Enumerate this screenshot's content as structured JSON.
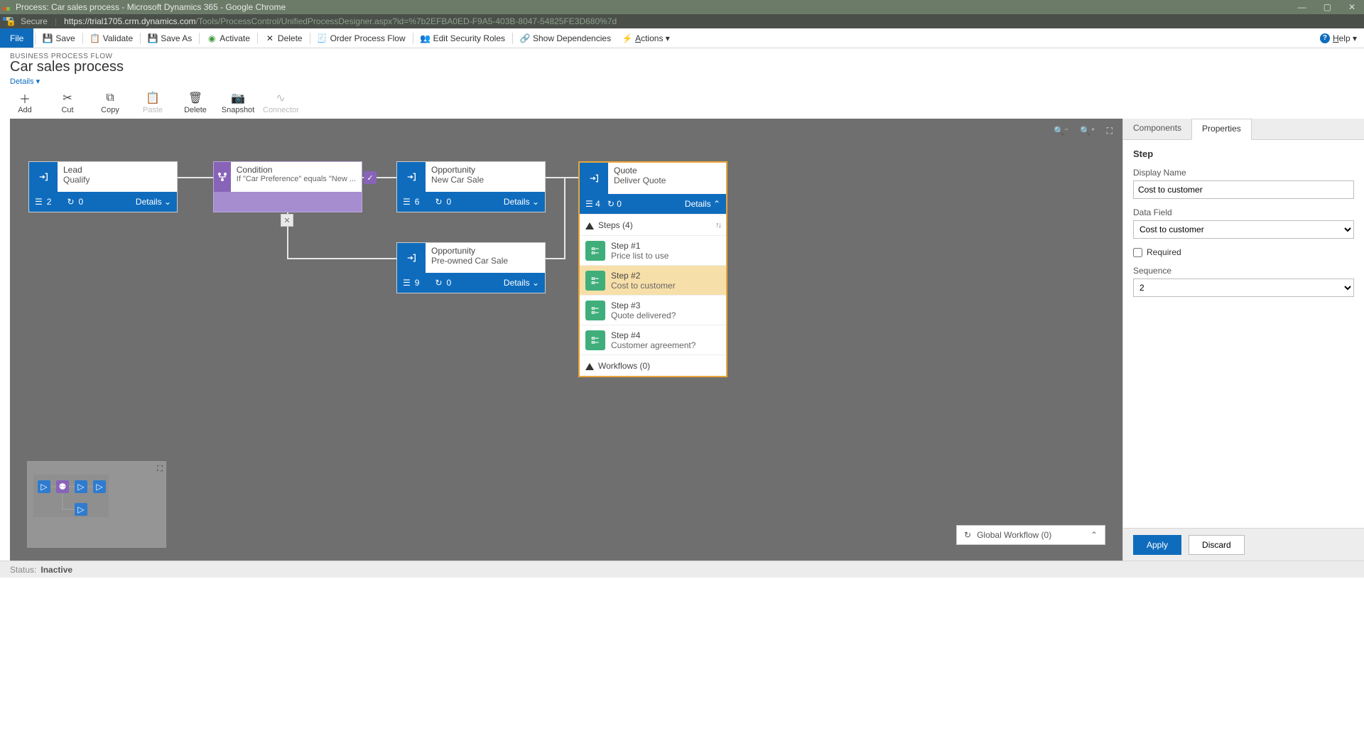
{
  "window": {
    "title": "Process: Car sales process - Microsoft Dynamics 365 - Google Chrome"
  },
  "addressbar": {
    "secure": "Secure",
    "host": "https://trial1705.crm.dynamics.com",
    "path": "/Tools/ProcessControl/UnifiedProcessDesigner.aspx?id=%7b2EFBA0ED-F9A5-403B-8047-54825FE3D680%7d"
  },
  "ribbon": {
    "file": "File",
    "save": "Save",
    "validate": "Validate",
    "saveas": "Save As",
    "activate": "Activate",
    "delete": "Delete",
    "orderflow": "Order Process Flow",
    "editsec": "Edit Security Roles",
    "showdep": "Show Dependencies",
    "actions": "Actions",
    "help": "Help"
  },
  "header": {
    "category": "BUSINESS PROCESS FLOW",
    "title": "Car sales process",
    "details": "Details"
  },
  "toolbar": {
    "add": "Add",
    "cut": "Cut",
    "copy": "Copy",
    "paste": "Paste",
    "delete": "Delete",
    "snapshot": "Snapshot",
    "connector": "Connector"
  },
  "stages": {
    "lead": {
      "name": "Lead",
      "sub": "Qualify",
      "steps": "2",
      "wf": "0",
      "details": "Details"
    },
    "cond": {
      "name": "Condition",
      "sub": "If \"Car Preference\" equals \"New ..."
    },
    "opp1": {
      "name": "Opportunity",
      "sub": "New Car Sale",
      "steps": "6",
      "wf": "0",
      "details": "Details"
    },
    "opp2": {
      "name": "Opportunity",
      "sub": "Pre-owned Car Sale",
      "steps": "9",
      "wf": "0",
      "details": "Details"
    },
    "quote": {
      "name": "Quote",
      "sub": "Deliver Quote",
      "steps": "4",
      "wf": "0",
      "details": "Details",
      "stepsHeader": "Steps (4)",
      "items": [
        {
          "t": "Step #1",
          "s": "Price list to use"
        },
        {
          "t": "Step #2",
          "s": "Cost to customer"
        },
        {
          "t": "Step #3",
          "s": "Quote delivered?"
        },
        {
          "t": "Step #4",
          "s": "Customer agreement?"
        }
      ],
      "wfHeader": "Workflows (0)"
    }
  },
  "globalwf": "Global Workflow (0)",
  "panel": {
    "tabComponents": "Components",
    "tabProperties": "Properties",
    "section": "Step",
    "displayNameLabel": "Display Name",
    "displayNameValue": "Cost to customer",
    "dataFieldLabel": "Data Field",
    "dataFieldValue": "Cost to customer",
    "requiredLabel": "Required",
    "sequenceLabel": "Sequence",
    "sequenceValue": "2",
    "apply": "Apply",
    "discard": "Discard"
  },
  "status": {
    "label": "Status:",
    "value": "Inactive"
  }
}
